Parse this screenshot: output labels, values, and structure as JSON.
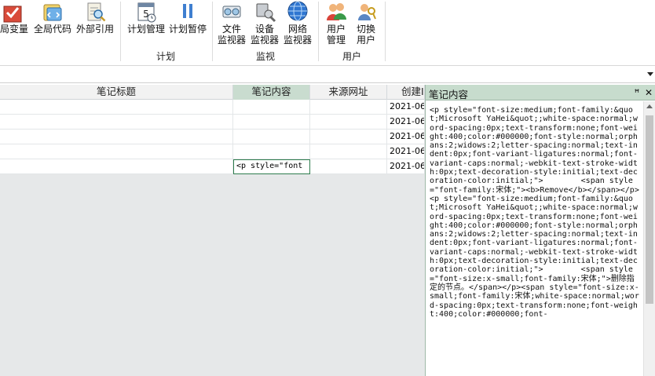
{
  "ribbon": {
    "groups": [
      {
        "id": "misc",
        "label": "",
        "buttons": [
          {
            "label": "局变量",
            "icon": "variable-icon"
          },
          {
            "label": "全局代码",
            "icon": "global-code-icon"
          },
          {
            "label": "外部引用",
            "icon": "external-reference-icon"
          }
        ]
      },
      {
        "id": "plan",
        "label": "计划",
        "buttons": [
          {
            "label": "计划管理",
            "icon": "calendar-icon"
          },
          {
            "label": "计划暂停",
            "icon": "pause-icon"
          }
        ]
      },
      {
        "id": "monitor",
        "label": "监视",
        "buttons": [
          {
            "label": "文件\n监视器",
            "icon": "file-monitor-icon"
          },
          {
            "label": "设备\n监视器",
            "icon": "device-monitor-icon"
          },
          {
            "label": "网络\n监视器",
            "icon": "globe-icon"
          }
        ]
      },
      {
        "id": "user",
        "label": "用户",
        "buttons": [
          {
            "label": "用户\n管理",
            "icon": "users-icon"
          },
          {
            "label": "切换\n用户",
            "icon": "switch-user-icon"
          }
        ]
      }
    ]
  },
  "grid": {
    "columns": [
      "笔记标题",
      "笔记内容",
      "来源网址",
      "创建I"
    ],
    "rows": [
      {
        "title": "",
        "content": "",
        "url": "",
        "date": "2021-06"
      },
      {
        "title": "",
        "content": "",
        "url": "",
        "date": "2021-06"
      },
      {
        "title": "",
        "content": "",
        "url": "",
        "date": "2021-06"
      },
      {
        "title": "",
        "content": "",
        "url": "",
        "date": "2021-06"
      },
      {
        "title": "",
        "content": "<p style=\"font",
        "url": "",
        "date": "2021-06"
      }
    ]
  },
  "panel": {
    "title": "笔记内容",
    "pin_glyph": "ꟸ",
    "close_glyph": "✕",
    "content": "<p style=\"font-size:medium;font-family:&quot;Microsoft YaHei&quot;;white-space:normal;word-spacing:0px;text-transform:none;font-weight:400;color:#000000;font-style:normal;orphans:2;widows:2;letter-spacing:normal;text-indent:0px;font-variant-ligatures:normal;font-variant-caps:normal;-webkit-text-stroke-width:0px;text-decoration-style:initial;text-decoration-color:initial;\">        <span style=\"font-family:宋体;\"><b>Remove</b></span></p><p style=\"font-size:medium;font-family:&quot;Microsoft YaHei&quot;;white-space:normal;word-spacing:0px;text-transform:none;font-weight:400;color:#000000;font-style:normal;orphans:2;widows:2;letter-spacing:normal;text-indent:0px;font-variant-ligatures:normal;font-variant-caps:normal;-webkit-text-stroke-width:0px;text-decoration-style:initial;text-decoration-color:initial;\">        <span style=\"font-size:x-small;font-family:宋体;\">删除指定的节点。</span></p><span style=\"font-size:x-small;font-family:宋体;white-space:normal;word-spacing:0px;text-transform:none;font-weight:400;color:#000000;font-"
  }
}
